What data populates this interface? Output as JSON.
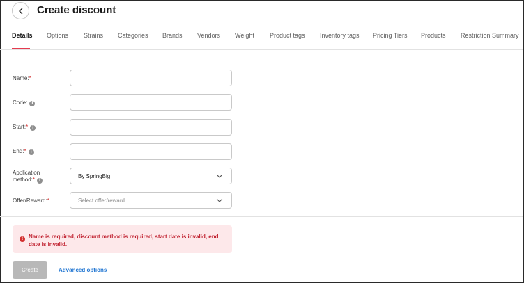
{
  "header": {
    "title": "Create discount",
    "back_icon": "chevron-left-icon"
  },
  "tabs": [
    {
      "label": "Details",
      "active": true
    },
    {
      "label": "Options"
    },
    {
      "label": "Strains"
    },
    {
      "label": "Categories"
    },
    {
      "label": "Brands"
    },
    {
      "label": "Vendors"
    },
    {
      "label": "Weight"
    },
    {
      "label": "Product tags"
    },
    {
      "label": "Inventory tags"
    },
    {
      "label": "Pricing Tiers"
    },
    {
      "label": "Products"
    },
    {
      "label": "Restriction Summary"
    }
  ],
  "form": {
    "name": {
      "label": "Name:",
      "required": "*",
      "value": ""
    },
    "code": {
      "label": "Code:",
      "info_icon": "info-icon",
      "value": ""
    },
    "start": {
      "label": "Start:",
      "required": "*",
      "info_icon": "info-icon",
      "value": ""
    },
    "end": {
      "label": "End:",
      "required": "*",
      "info_icon": "info-icon",
      "value": ""
    },
    "application_method": {
      "label_line1": "Application",
      "label_line2": "method:",
      "required": "*",
      "info_icon": "info-icon",
      "value": "By SpringBig"
    },
    "offer_reward": {
      "label": "Offer/Reward:",
      "required": "*",
      "placeholder": "Select offer/reward"
    }
  },
  "error": {
    "icon": "alert-icon",
    "message": "Name is required, discount method is required, start date is invalid, end date is invalid."
  },
  "actions": {
    "create_label": "Create",
    "advanced_label": "Advanced options"
  },
  "colors": {
    "accent": "#e53b4f",
    "error_bg": "#fde8ea",
    "error_text": "#c0202f",
    "link": "#2176d2",
    "disabled_button": "#b8b8b8"
  }
}
